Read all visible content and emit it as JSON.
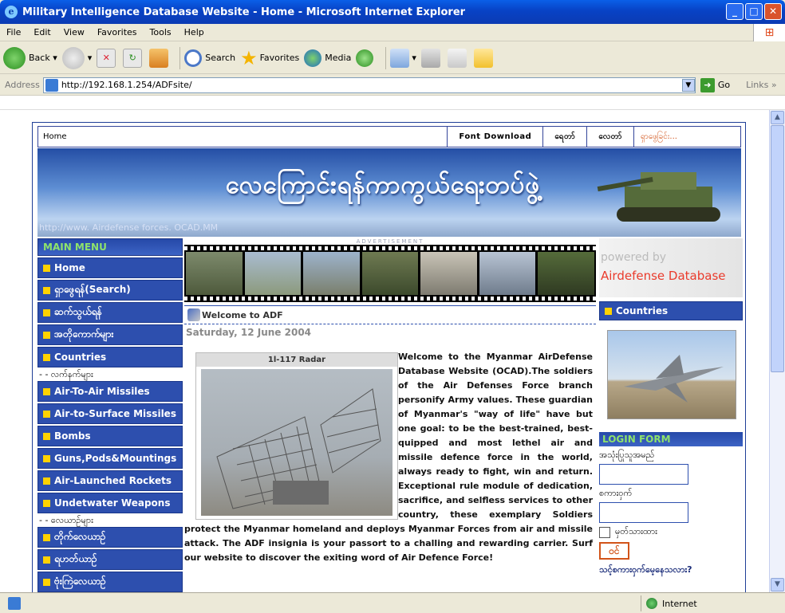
{
  "window": {
    "title": "Military Intelligence Database Website - Home - Microsoft Internet Explorer"
  },
  "menubar": [
    "File",
    "Edit",
    "View",
    "Favorites",
    "Tools",
    "Help"
  ],
  "toolbar": {
    "back": "Back",
    "search": "Search",
    "favorites": "Favorites",
    "media": "Media"
  },
  "address": {
    "label": "Address",
    "url": "http://192.168.1.254/ADFsite/",
    "go": "Go",
    "links": "Links"
  },
  "status": {
    "zone": "Internet"
  },
  "nav": {
    "home": "Home",
    "font_download": "Font Download",
    "item2": "ရေတာ်",
    "item3": "လေတာ်",
    "search_placeholder": "ရှာဖွေခြင်း..."
  },
  "banner": {
    "title": "လေကြောင်းရန်ကာကွယ်ရေးတပ်ဖွဲ့",
    "url_text": "http://www. Airdefense forces. OCAD.MM"
  },
  "main_menu": {
    "title": "MAIN MENU",
    "items": [
      {
        "label": "Home"
      },
      {
        "label": "ရှာဖွေရန်(Search)"
      },
      {
        "label": "ဆက်သွယ်ရန်"
      },
      {
        "label": "အတိုကောက်များ"
      },
      {
        "label": "Countries"
      }
    ],
    "sub1": "- - လက်နက်များ",
    "weapons": [
      {
        "label": "Air-To-Air Missiles"
      },
      {
        "label": "Air-to-Surface Missiles"
      },
      {
        "label": "Bombs"
      },
      {
        "label": "Guns,Pods&Mountings"
      },
      {
        "label": "Air-Launched Rockets"
      },
      {
        "label": "Undetwater Weapons"
      }
    ],
    "sub2": "- - လေယာဉ်များ",
    "aircraft": [
      {
        "label": "တိုက်လေယာဉ်"
      },
      {
        "label": "ရဟတ်ယာဉ်"
      },
      {
        "label": "ဗုံးကြဲလေယာဉ်"
      }
    ]
  },
  "center": {
    "ad_label": "ADVERTISEMENT",
    "welcome": "Welcome to ADF",
    "date": "Saturday, 12 June 2004",
    "image_caption": "1l-117 Radar",
    "article": "Welcome to the Myanmar AirDefense Database Website (OCAD).The soldiers of the Air Defenses Force branch personify Army values. These guardian of Myanmar's \"way of life\" have but one goal: to be the best-trained, best-quipped and most lethel air and missile defence force in the world, always ready to fight, win and return. Exceptional rule module of dedication, sacrifice, and selfless services to other country, these exemplary Soldiers protect the Myanmar homeland and deploys Myanmar Forces from air and missile attack. The ADF insignia is your passort to a challing and rewarding carrier. Surf our website to discover the exiting word of Air Defence Force!"
  },
  "right": {
    "powered": "powered by",
    "brand": "Airdefense Database",
    "countries": "Countries",
    "login_title": "LOGIN FORM",
    "username_label": "အသုံးပြုသူအမည်",
    "password_label": "စကားဝှက်",
    "remember_label": "မှတ်သားထား",
    "submit": "ဝင်",
    "forgot": "သင့်စကားဝှက်မေ့နေသလား?"
  }
}
